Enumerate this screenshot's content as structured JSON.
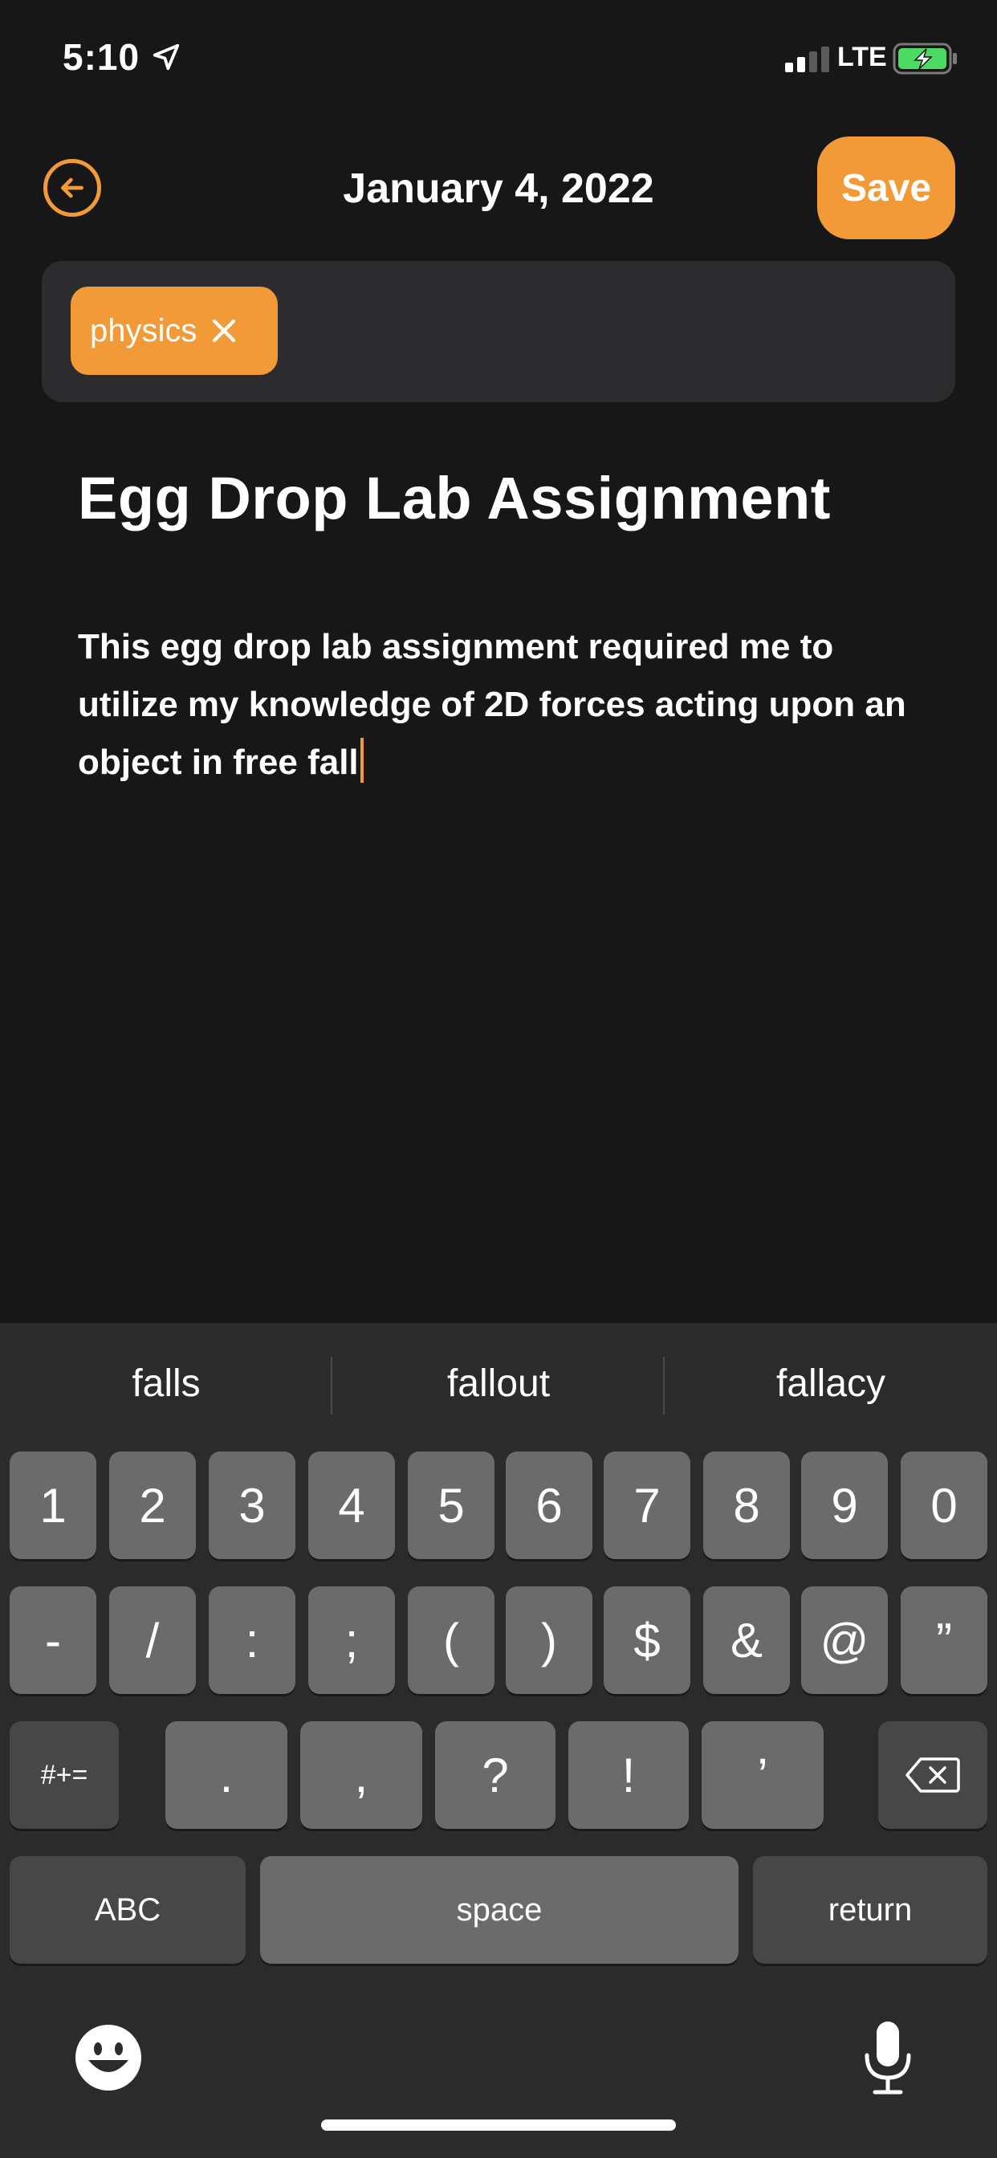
{
  "status_bar": {
    "time": "5:10",
    "network": "LTE"
  },
  "header": {
    "date": "January 4, 2022",
    "save_label": "Save"
  },
  "tags": [
    {
      "label": "physics"
    }
  ],
  "note": {
    "title": "Egg Drop Lab Assignment",
    "body": "This egg drop lab assignment required me to utilize my knowledge of 2D forces acting upon an object in free fall"
  },
  "keyboard": {
    "suggestions": [
      "falls",
      "fallout",
      "fallacy"
    ],
    "row1": [
      "1",
      "2",
      "3",
      "4",
      "5",
      "6",
      "7",
      "8",
      "9",
      "0"
    ],
    "row2": [
      "-",
      "/",
      ":",
      ";",
      "(",
      ")",
      "$",
      "&",
      "@",
      "”"
    ],
    "row3": {
      "mode_key": "#+=",
      "keys": [
        ".",
        ",",
        "?",
        "!",
        "’"
      ]
    },
    "row4": {
      "abc": "ABC",
      "space": "space",
      "return": "return"
    }
  },
  "colors": {
    "accent": "#F19A37",
    "background": "#171717",
    "tag_bar": "#2C2C2E",
    "keyboard_bg": "#2B2B2B",
    "key": "#6B6B6B",
    "key_dark": "#474747"
  },
  "icons": {
    "back": "arrow-left-circle-icon",
    "location": "location-arrow-icon",
    "signal": "cellular-signal-icon",
    "battery": "battery-charging-icon",
    "tag_remove": "close-icon",
    "delete": "backspace-icon",
    "emoji": "emoji-icon",
    "mic": "microphone-icon"
  }
}
